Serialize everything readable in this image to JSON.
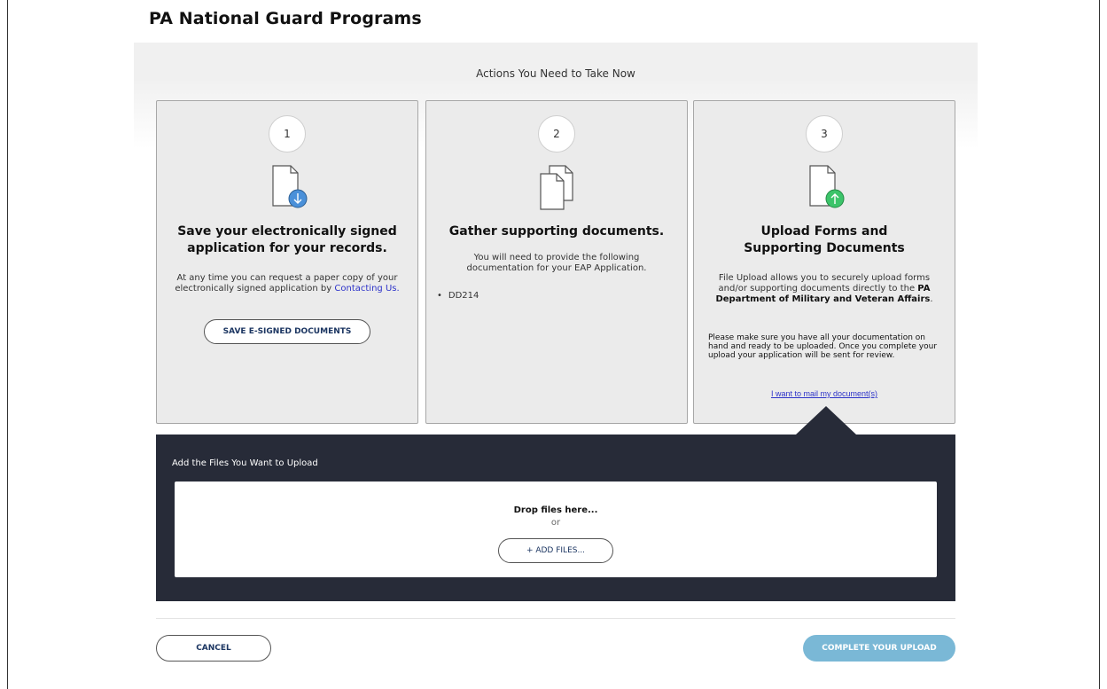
{
  "page": {
    "title": "PA National Guard Programs"
  },
  "actions": {
    "heading": "Actions You Need to Take Now",
    "steps": [
      {
        "number": "1",
        "icon": "document-download-icon",
        "title": "Save your electronically signed application for your records.",
        "text": "At any time you can request a paper copy of your electronically signed application by",
        "link_label": "Contacting Us.",
        "button_label": "SAVE E-SIGNED DOCUMENTS"
      },
      {
        "number": "2",
        "icon": "documents-stack-icon",
        "title": "Gather supporting documents.",
        "text": "You will need to provide the following documentation for your EAP Application.",
        "items": [
          "DD214"
        ]
      },
      {
        "number": "3",
        "icon": "document-upload-icon",
        "title": "Upload Forms and Supporting Documents",
        "text_prefix": "File Upload allows you to securely upload forms and/or supporting documents directly to the",
        "text_bold": "PA Department of Military and Veteran Affairs",
        "text_suffix": ".",
        "note": "Please make sure you have all your documentation on hand and ready to be uploaded. Once you complete your upload your application will be sent for review.",
        "mail_link_label": "I want to mail my document(s)"
      }
    ]
  },
  "upload": {
    "heading": "Add the Files You Want to Upload",
    "drop_label": "Drop files here...",
    "or_label": "or",
    "add_button_label": "+ ADD FILES..."
  },
  "footer": {
    "cancel_label": "CANCEL",
    "complete_label": "COMPLETE YOUR UPLOAD"
  },
  "colors": {
    "accent_blue": "#4a90d9",
    "accent_green": "#3cc46a",
    "panel_dark": "#272b38",
    "complete_button": "#7ab8d6",
    "link": "#2d33c9"
  }
}
